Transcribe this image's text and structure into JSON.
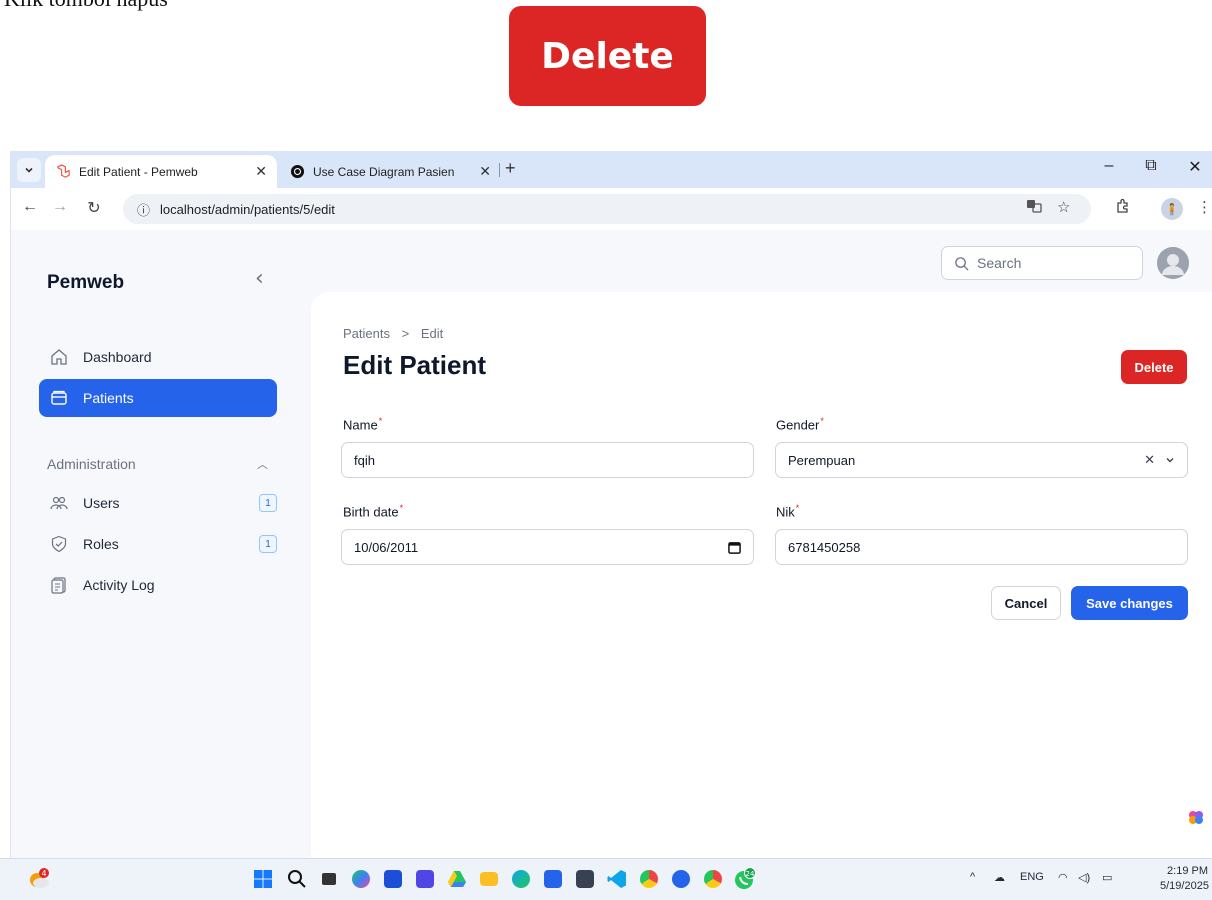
{
  "instruction": {
    "text": "Klik tombol hapus",
    "callout_label": "Delete"
  },
  "browser": {
    "tabs": [
      {
        "title": "Edit Patient - Pemweb",
        "active": true
      },
      {
        "title": "Use Case Diagram Pasien",
        "active": false
      }
    ],
    "url": "localhost/admin/patients/5/edit",
    "controls": {
      "minimize": "–",
      "restore": "⧉",
      "close": "✕"
    }
  },
  "app": {
    "brand": "Pemweb",
    "search_placeholder": "Search",
    "sidebar": {
      "items": [
        {
          "label": "Dashboard",
          "icon": "home-icon"
        },
        {
          "label": "Patients",
          "icon": "folder-icon",
          "active": true
        }
      ],
      "group": {
        "label": "Administration",
        "items": [
          {
            "label": "Users",
            "icon": "users-icon",
            "badge": "1"
          },
          {
            "label": "Roles",
            "icon": "shield-icon",
            "badge": "1"
          },
          {
            "label": "Activity Log",
            "icon": "clipboard-icon"
          }
        ]
      }
    },
    "page": {
      "breadcrumb": [
        "Patients",
        "Edit"
      ],
      "breadcrumb_sep": ">",
      "title": "Edit Patient",
      "delete_label": "Delete",
      "fields": {
        "name": {
          "label": "Name",
          "value": "fqih"
        },
        "gender": {
          "label": "Gender",
          "value": "Perempuan"
        },
        "birth_date": {
          "label": "Birth date",
          "value": "10/06/2011"
        },
        "nik": {
          "label": "Nik",
          "value": "6781450258"
        }
      },
      "required_mark": "*",
      "cancel_label": "Cancel",
      "save_label": "Save changes"
    }
  },
  "taskbar": {
    "weather_badge": "4",
    "whatsapp_badge": "24",
    "language": "ENG",
    "time": "2:19 PM",
    "date": "5/19/2025"
  },
  "colors": {
    "primary": "#2563eb",
    "danger": "#dc2626",
    "tabbar": "#d9e6fa"
  }
}
